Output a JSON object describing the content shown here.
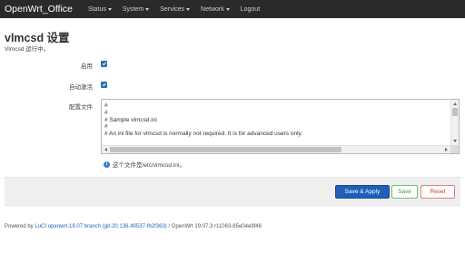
{
  "navbar": {
    "brand": "OpenWrt_Office",
    "items": [
      {
        "label": "Status",
        "has_dropdown": true
      },
      {
        "label": "System",
        "has_dropdown": true
      },
      {
        "label": "Services",
        "has_dropdown": true
      },
      {
        "label": "Network",
        "has_dropdown": true
      },
      {
        "label": "Logout",
        "has_dropdown": false
      }
    ]
  },
  "page": {
    "title": "vlmcsd 设置",
    "status": "Vlmcsd 运行中。"
  },
  "form": {
    "enable_label": "启用",
    "enable_checked": true,
    "autostart_label": "自动激活",
    "autostart_checked": true,
    "config_label": "配置文件",
    "config_text": "#\n#\n# Sample vlmcsd.ini\n#\n# An ini file for vlmcsd is normally not required. It is for advanced users only.",
    "hint": "这个文件是/etc/vlmcsd.ini。"
  },
  "actions": {
    "save_apply": "Save & Apply",
    "save": "Save",
    "reset": "Reset"
  },
  "footer": {
    "powered_prefix": "Powered by ",
    "luci_link": "LuCI openwrt-19.07 branch (git-20.136.49537-fb2f363)",
    "rest": " / OpenWrt 19.07.3 r11063-85e04e9f46"
  },
  "colors": {
    "navbar_bg": "#2a2a2a",
    "primary_button": "#1f5fb8",
    "save_button_border": "#6fbf6f",
    "reset_button_border": "#e08080",
    "checkbox_checked": "#2c6fb7"
  }
}
